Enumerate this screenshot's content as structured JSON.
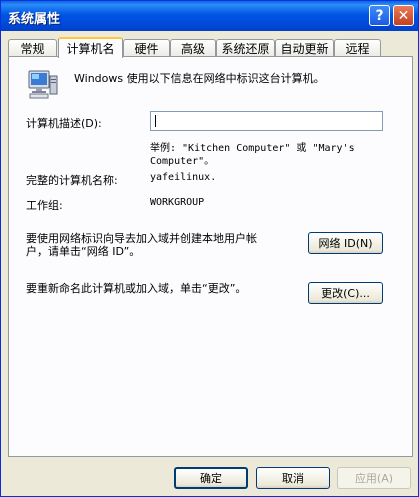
{
  "window": {
    "title": "系统属性"
  },
  "titlebar": {
    "help_glyph": "?",
    "close_glyph": "✕"
  },
  "tabs": [
    {
      "label": "常规"
    },
    {
      "label": "计算机名",
      "active": true
    },
    {
      "label": "硬件"
    },
    {
      "label": "高级"
    },
    {
      "label": "系统还原"
    },
    {
      "label": "自动更新"
    },
    {
      "label": "远程"
    }
  ],
  "computer_name": {
    "intro": "Windows 使用以下信息在网络中标识这台计算机。",
    "description_label": "计算机描述(D):",
    "description_value": "",
    "example_line1": "举例: \"Kitchen Computer\" 或 \"Mary's",
    "example_line2": "Computer\"。",
    "full_name_label": "完整的计算机名称:",
    "full_name_value": "yafeilinux.",
    "workgroup_label": "工作组:",
    "workgroup_value": "WORKGROUP",
    "network_id_text_line1": "要使用网络标识向导去加入域并创建本地用户帐",
    "network_id_text_line2": "户，请单击“网络 ID”。",
    "network_id_button": "网络 ID(N)",
    "rename_text": "要重新命名此计算机或加入域，单击“更改”。",
    "change_button": "更改(C)..."
  },
  "footer": {
    "ok": "确定",
    "cancel": "取消",
    "apply": "应用(A)"
  },
  "icons": [
    "computer-icon",
    "help-icon",
    "close-icon"
  ],
  "colors": {
    "titlebar": "#0055e5",
    "active_tab_accent": "#ffc83c",
    "dialog_bg": "#ece9d8"
  }
}
